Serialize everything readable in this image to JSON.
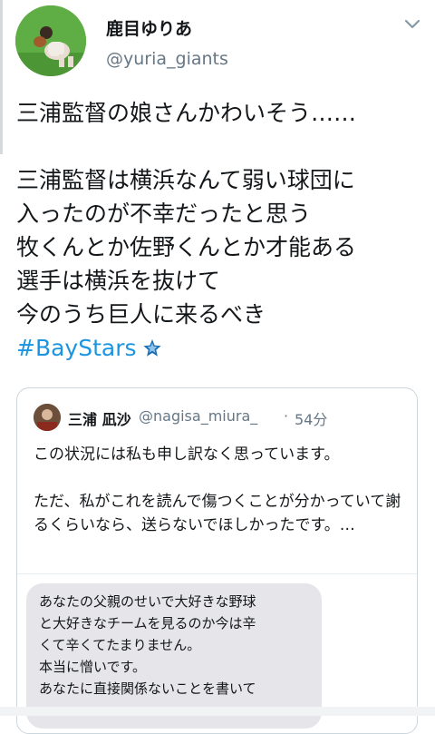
{
  "tweet": {
    "author": {
      "display_name": "鹿目ゆりあ",
      "handle": "@yuria_giants",
      "avatar": "baseball-catcher-photo"
    },
    "menu_icon": "chevron-down-icon",
    "text": "三浦監督の娘さんかわいそう……\n\n三浦監督は横浜なんて弱い球団に\n入ったのが不幸だったと思う\n牧くんとか佐野くんとか才能ある\n選手は横浜を抜けて\n今のうち巨人に来るべき",
    "hashtag": "#BayStars",
    "hashtag_emoji": "baystars-star-icon"
  },
  "quoted_tweet": {
    "display_name": "三浦 凪沙",
    "handle": "@nagisa_miura_",
    "separator": "·",
    "time": "54分",
    "text": "この状況には私も申し訳なく思っています。\n\nただ、私がこれを読んで傷つくことが分かっていて謝るくらいなら、送らないでほしかったです。…",
    "image_message": "あなたの父親のせいで大好きな野球\nと大好きなチームを見るのか今は辛\nくて辛くてたまりません。\n本当に憎いです。\nあなたに直接関係ないことを書いて"
  },
  "colors": {
    "text": "#14171a",
    "secondary": "#657786",
    "link": "#1b95e0",
    "border": "#ccd6dd",
    "bubble": "#e5e5ea"
  }
}
